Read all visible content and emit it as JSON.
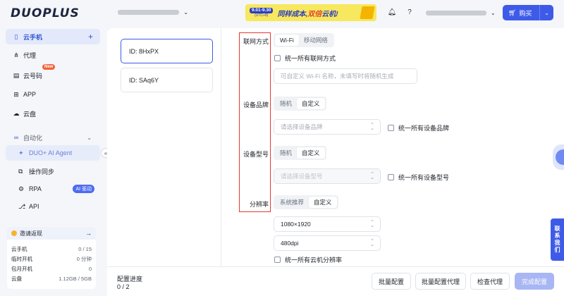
{
  "brand": {
    "logo": "DUOPLUS"
  },
  "sidebar": {
    "items": [
      {
        "label": "云手机",
        "icon": "phone-icon",
        "active": true
      },
      {
        "label": "代理",
        "icon": "network-icon"
      },
      {
        "label": "云号码",
        "icon": "sim-icon",
        "badge": "New"
      },
      {
        "label": "APP",
        "icon": "apps-icon"
      },
      {
        "label": "云盘",
        "icon": "cloud-icon"
      }
    ],
    "automation": {
      "label": "自动化",
      "icon": "infinity-icon"
    },
    "sub_items": [
      {
        "label": "DUO+ AI Agent",
        "icon": "agent-icon",
        "active": true
      },
      {
        "label": "操作同步",
        "icon": "sync-icon"
      },
      {
        "label": "RPA",
        "icon": "rpa-icon",
        "badge": "AI 驱动"
      },
      {
        "label": "API",
        "icon": "api-icon"
      }
    ],
    "collapse_glyph": "«",
    "quota": {
      "invite_label": "邀请返现",
      "rows": [
        {
          "label": "云手机",
          "value": "0 / 15"
        },
        {
          "label": "临时开机",
          "value": "0 分钟"
        },
        {
          "label": "包月开机",
          "value": "0"
        },
        {
          "label": "云盘",
          "value": "1.12GB / 5GB"
        }
      ]
    }
  },
  "topbar": {
    "promo": {
      "date": "9.01-9.30",
      "tz": "(UTC+8)",
      "text_a": "同样成本,",
      "text_b": "双倍",
      "text_c": "云机!"
    },
    "buy_label": "购买"
  },
  "devices": [
    {
      "id": "ID: 8HxPX",
      "selected": true
    },
    {
      "id": "ID: SAq6Y",
      "selected": false
    }
  ],
  "form": {
    "network": {
      "label": "联网方式",
      "options": [
        "Wi-Fi",
        "移动网络"
      ],
      "unify": "统一所有联网方式",
      "wifi_placeholder": "可自定义 Wi-Fi 名称，未填写时将随机生成"
    },
    "brand": {
      "label": "设备品牌",
      "options": [
        "随机",
        "自定义"
      ],
      "placeholder": "请选择设备品牌",
      "unify": "统一所有设备品牌"
    },
    "model": {
      "label": "设备型号",
      "options": [
        "随机",
        "自定义"
      ],
      "placeholder": "请选择设备型号",
      "unify": "统一所有设备型号"
    },
    "resolution": {
      "label": "分辨率",
      "options": [
        "系统推荐",
        "自定义"
      ],
      "value": "1080×1920",
      "dpi": "480dpi",
      "unify": "统一所有云机分辨率"
    }
  },
  "footer": {
    "progress_label": "配置进度",
    "progress_value": "0 / 2",
    "buttons": [
      "批量配置",
      "批量配置代理",
      "检查代理",
      "完成配置"
    ]
  },
  "contact": [
    "联",
    "系",
    "我",
    "们"
  ]
}
